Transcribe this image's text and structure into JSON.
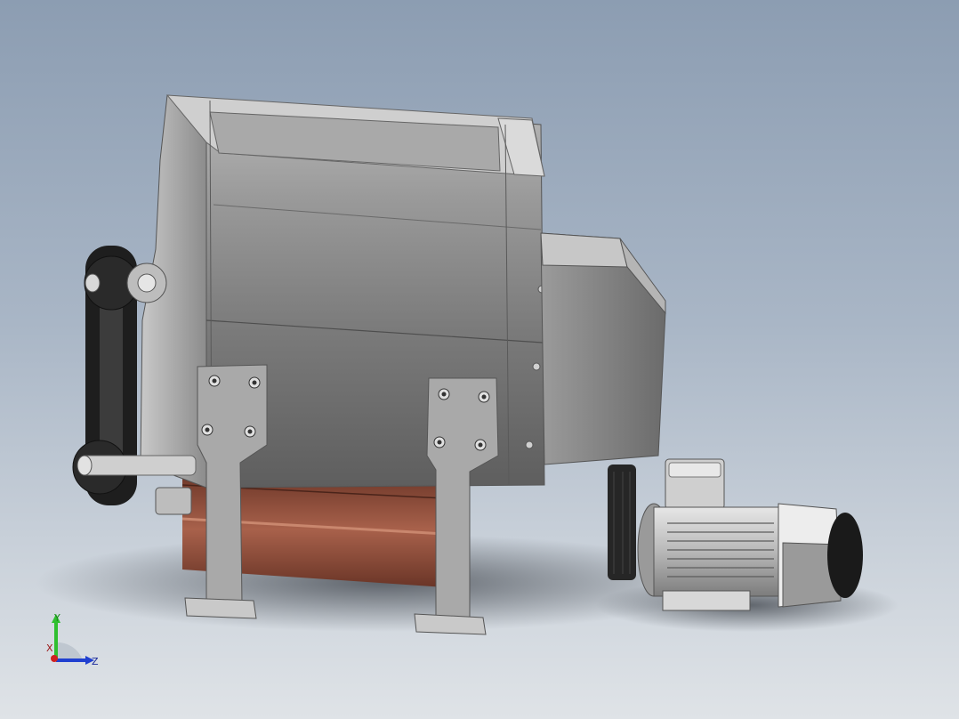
{
  "scene": {
    "object": "mixer-with-motor-drive"
  },
  "triad": {
    "y_label": "Y",
    "z_label": "Z",
    "x_label": "X",
    "colors": {
      "y": "#2fbf2f",
      "z": "#2040d0",
      "x": "#d02020"
    }
  },
  "colors": {
    "background_top": "#8c9db2",
    "background_bottom": "#dfe3e7",
    "steel": "#8a8a8a",
    "copper": "#8a4a38",
    "belt": "#202020"
  }
}
